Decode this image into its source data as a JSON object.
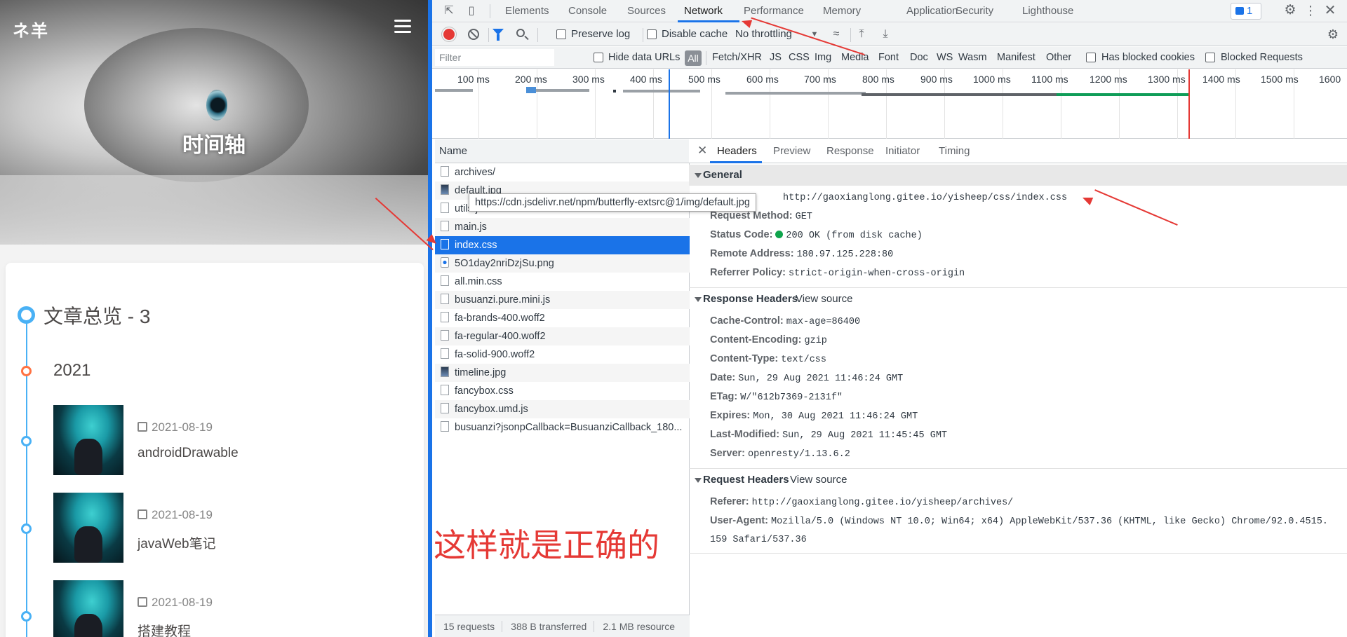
{
  "blog": {
    "brand": "ネ羊",
    "hero_title": "时间轴",
    "overview_title": "文章总览 - 3",
    "year": "2021",
    "posts": [
      {
        "date": "2021-08-19",
        "title": "androidDrawable"
      },
      {
        "date": "2021-08-19",
        "title": "javaWeb笔记"
      },
      {
        "date": "2021-08-19",
        "title": "搭建教程"
      }
    ]
  },
  "devtools": {
    "tabs": [
      "Elements",
      "Console",
      "Sources",
      "Network",
      "Performance",
      "Memory",
      "Application",
      "Security",
      "Lighthouse"
    ],
    "active_tab": "Network",
    "issues_count": "1",
    "toolbar": {
      "preserve_log": "Preserve log",
      "disable_cache": "Disable cache",
      "throttling": "No throttling"
    },
    "filterbar": {
      "filter_placeholder": "Filter",
      "hide_data_urls": "Hide data URLs",
      "all": "All",
      "types": [
        "Fetch/XHR",
        "JS",
        "CSS",
        "Img",
        "Media",
        "Font",
        "Doc",
        "WS",
        "Wasm",
        "Manifest",
        "Other"
      ],
      "has_blocked_cookies": "Has blocked cookies",
      "blocked_requests": "Blocked Requests"
    },
    "overview_ticks": [
      "100 ms",
      "200 ms",
      "300 ms",
      "400 ms",
      "500 ms",
      "600 ms",
      "700 ms",
      "800 ms",
      "900 ms",
      "1000 ms",
      "1100 ms",
      "1200 ms",
      "1300 ms",
      "1400 ms",
      "1500 ms",
      "1600"
    ],
    "name_header": "Name",
    "requests": [
      {
        "name": "archives/",
        "icon": "doc"
      },
      {
        "name": "default.jpg",
        "icon": "img"
      },
      {
        "name": "utils.js",
        "icon": "doc"
      },
      {
        "name": "main.js",
        "icon": "doc"
      },
      {
        "name": "index.css",
        "icon": "doc"
      },
      {
        "name": "5O1day2nriDzjSu.png",
        "icon": "png"
      },
      {
        "name": "all.min.css",
        "icon": "doc"
      },
      {
        "name": "busuanzi.pure.mini.js",
        "icon": "doc"
      },
      {
        "name": "fa-brands-400.woff2",
        "icon": "doc"
      },
      {
        "name": "fa-regular-400.woff2",
        "icon": "doc"
      },
      {
        "name": "fa-solid-900.woff2",
        "icon": "doc"
      },
      {
        "name": "timeline.jpg",
        "icon": "img"
      },
      {
        "name": "fancybox.css",
        "icon": "doc"
      },
      {
        "name": "fancybox.umd.js",
        "icon": "doc"
      },
      {
        "name": "busuanzi?jsonpCallback=BusuanziCallback_180...",
        "icon": "doc"
      }
    ],
    "selected_request": "index.css",
    "tooltip": "https://cdn.jsdelivr.net/npm/butterfly-extsrc@1/img/default.jpg",
    "status": {
      "requests": "15 requests",
      "transferred": "388 B transferred",
      "resources": "2.1 MB resource"
    },
    "annotation": "这样就是正确的",
    "detail_tabs": [
      "Headers",
      "Preview",
      "Response",
      "Initiator",
      "Timing"
    ],
    "general": {
      "title": "General",
      "request_url": "http://gaoxianglong.gitee.io/yisheep/css/index.css",
      "request_method_label": "Request Method:",
      "request_method": "GET",
      "status_code_label": "Status Code:",
      "status_code": "200 OK (from disk cache)",
      "remote_address_label": "Remote Address:",
      "remote_address": "180.97.125.228:80",
      "referrer_policy_label": "Referrer Policy:",
      "referrer_policy": "strict-origin-when-cross-origin"
    },
    "response_headers": {
      "title": "Response Headers",
      "view_source": "View source",
      "items": [
        {
          "k": "Cache-Control:",
          "v": "max-age=86400"
        },
        {
          "k": "Content-Encoding:",
          "v": "gzip"
        },
        {
          "k": "Content-Type:",
          "v": "text/css"
        },
        {
          "k": "Date:",
          "v": "Sun, 29 Aug 2021 11:46:24 GMT"
        },
        {
          "k": "ETag:",
          "v": "W/\"612b7369-2131f\""
        },
        {
          "k": "Expires:",
          "v": "Mon, 30 Aug 2021 11:46:24 GMT"
        },
        {
          "k": "Last-Modified:",
          "v": "Sun, 29 Aug 2021 11:45:45 GMT"
        },
        {
          "k": "Server:",
          "v": "openresty/1.13.6.2"
        }
      ]
    },
    "request_headers": {
      "title": "Request Headers",
      "view_source": "View source",
      "referer_label": "Referer:",
      "referer": "http://gaoxianglong.gitee.io/yisheep/archives/",
      "user_agent_label": "User-Agent:",
      "user_agent_line1": "Mozilla/5.0 (Windows NT 10.0; Win64; x64) AppleWebKit/537.36 (KHTML, like Gecko) Chrome/92.0.4515.",
      "user_agent_line2": "159 Safari/537.36"
    }
  }
}
